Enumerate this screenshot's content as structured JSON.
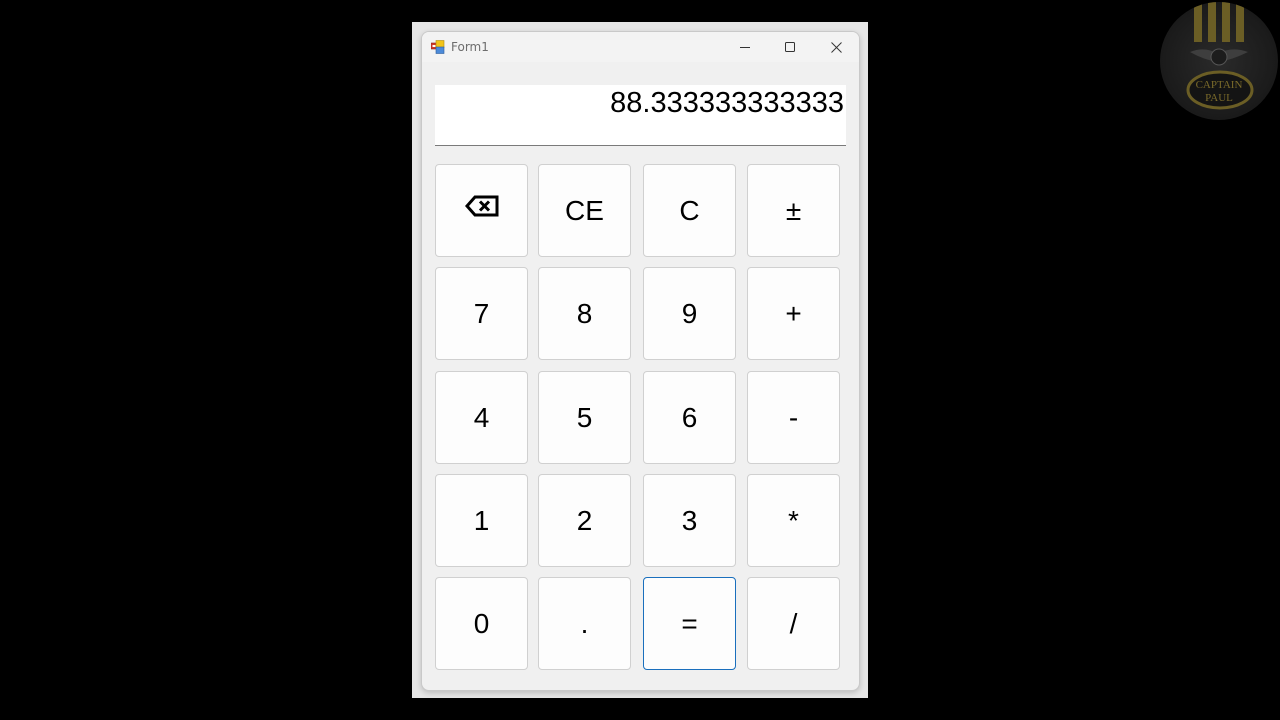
{
  "window": {
    "title": "Form1",
    "app_icon": "winforms-app-icon",
    "controls": {
      "minimize": "minimize-icon",
      "maximize": "maximize-icon",
      "close": "close-icon"
    }
  },
  "display": {
    "value": "88.333333333333"
  },
  "keypad": {
    "rows": [
      [
        {
          "id": "backspace",
          "label": "",
          "icon": "backspace-icon"
        },
        {
          "id": "clear-entry",
          "label": "CE"
        },
        {
          "id": "clear",
          "label": "C"
        },
        {
          "id": "negate",
          "label": "±"
        }
      ],
      [
        {
          "id": "seven",
          "label": "7"
        },
        {
          "id": "eight",
          "label": "8"
        },
        {
          "id": "nine",
          "label": "9"
        },
        {
          "id": "plus",
          "label": "+"
        }
      ],
      [
        {
          "id": "four",
          "label": "4"
        },
        {
          "id": "five",
          "label": "5"
        },
        {
          "id": "six",
          "label": "6"
        },
        {
          "id": "minus",
          "label": "-"
        }
      ],
      [
        {
          "id": "one",
          "label": "1"
        },
        {
          "id": "two",
          "label": "2"
        },
        {
          "id": "three",
          "label": "3"
        },
        {
          "id": "multiply",
          "label": "*"
        }
      ],
      [
        {
          "id": "zero",
          "label": "0"
        },
        {
          "id": "decimal",
          "label": "."
        },
        {
          "id": "equals",
          "label": "=",
          "focused": true
        },
        {
          "id": "divide",
          "label": "/"
        }
      ]
    ]
  },
  "watermark": {
    "line1": "CAPTAIN",
    "line2": "PAUL"
  },
  "colors": {
    "focus_border": "#1a6fbd",
    "key_background": "#fdfdfd",
    "window_background": "#f0f0f0"
  }
}
